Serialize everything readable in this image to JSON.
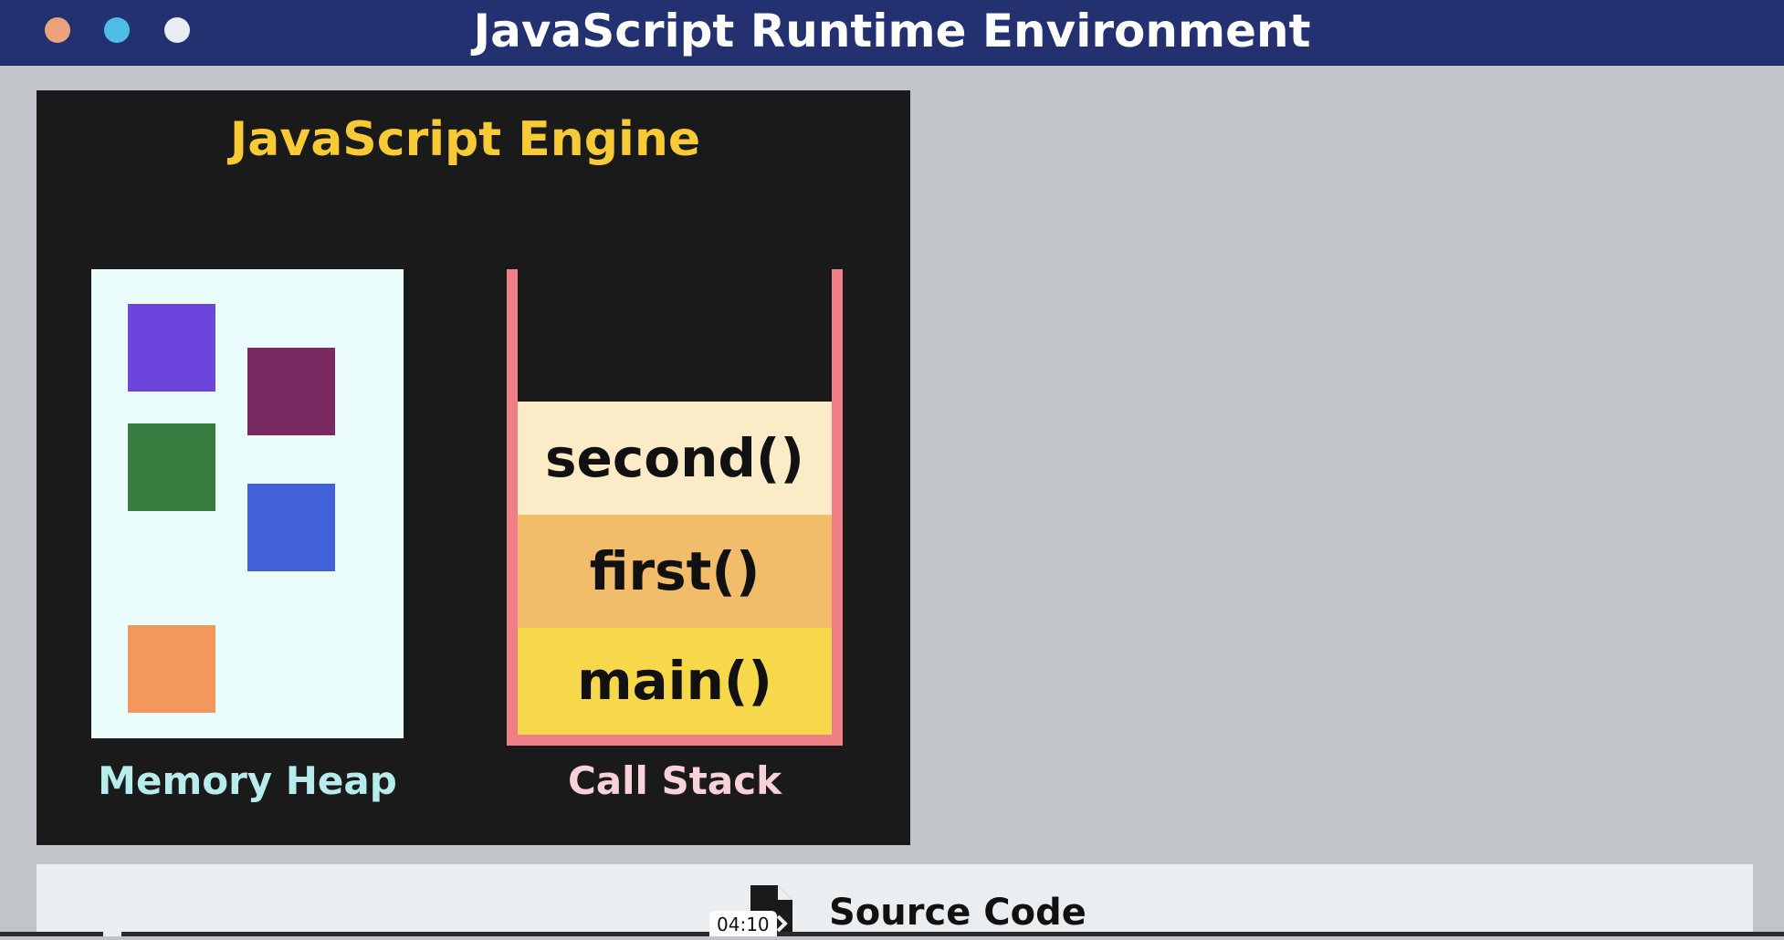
{
  "window": {
    "title": "JavaScript Runtime Environment",
    "controls": [
      "window-dot-orange",
      "window-dot-blue",
      "window-dot-white"
    ]
  },
  "engine": {
    "title": "JavaScript Engine",
    "memory_heap": {
      "label": "Memory Heap",
      "blocks": [
        {
          "color": "#6b45dc"
        },
        {
          "color": "#7a2a61"
        },
        {
          "color": "#367e3f"
        },
        {
          "color": "#4162d8"
        },
        {
          "color": "#f2985d"
        }
      ]
    },
    "call_stack": {
      "label": "Call Stack",
      "frames": [
        {
          "label": "second()",
          "color": "#fcebc7"
        },
        {
          "label": "first()",
          "color": "#f2bd6a"
        },
        {
          "label": "main()",
          "color": "#f6d84a"
        }
      ]
    }
  },
  "source": {
    "label": "Source Code",
    "icon": "file-code-icon"
  },
  "video": {
    "timestamp": "04:10"
  },
  "colors": {
    "titlebar": "#233170",
    "engine_bg": "#1a1a1a",
    "engine_title": "#f7ca36",
    "heap_bg": "#ebfcfc",
    "stack_border": "#ee7f86"
  }
}
